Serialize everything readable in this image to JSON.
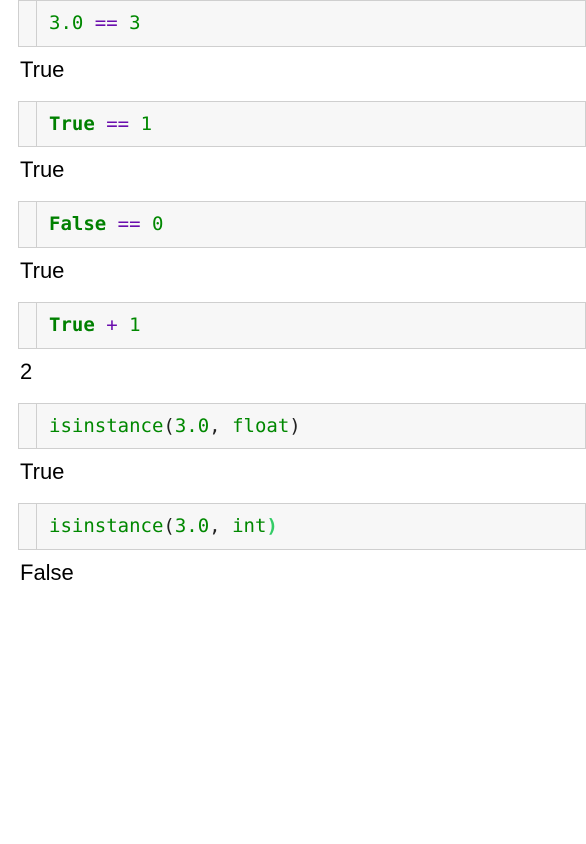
{
  "cells": [
    {
      "tokens": [
        {
          "text": "3.0",
          "cls": "tok-num"
        },
        {
          "text": " ",
          "cls": "sp"
        },
        {
          "text": "==",
          "cls": "tok-op"
        },
        {
          "text": " ",
          "cls": "sp"
        },
        {
          "text": "3",
          "cls": "tok-num"
        }
      ],
      "output": "True"
    },
    {
      "tokens": [
        {
          "text": "True",
          "cls": "tok-kw"
        },
        {
          "text": " ",
          "cls": "sp"
        },
        {
          "text": "==",
          "cls": "tok-op"
        },
        {
          "text": " ",
          "cls": "sp"
        },
        {
          "text": "1",
          "cls": "tok-num"
        }
      ],
      "output": "True"
    },
    {
      "tokens": [
        {
          "text": "False",
          "cls": "tok-kw"
        },
        {
          "text": " ",
          "cls": "sp"
        },
        {
          "text": "==",
          "cls": "tok-op"
        },
        {
          "text": " ",
          "cls": "sp"
        },
        {
          "text": "0",
          "cls": "tok-num"
        }
      ],
      "output": "True"
    },
    {
      "tokens": [
        {
          "text": "True",
          "cls": "tok-kw"
        },
        {
          "text": " ",
          "cls": "sp"
        },
        {
          "text": "+",
          "cls": "tok-op"
        },
        {
          "text": " ",
          "cls": "sp"
        },
        {
          "text": "1",
          "cls": "tok-num"
        }
      ],
      "output": "2"
    },
    {
      "tokens": [
        {
          "text": "isinstance",
          "cls": "tok-builtin"
        },
        {
          "text": "(",
          "cls": "tok-paren"
        },
        {
          "text": "3.0",
          "cls": "tok-num"
        },
        {
          "text": ",",
          "cls": "tok-comma"
        },
        {
          "text": " ",
          "cls": "sp"
        },
        {
          "text": "float",
          "cls": "tok-builtin"
        },
        {
          "text": ")",
          "cls": "tok-paren"
        }
      ],
      "output": "True"
    },
    {
      "tokens": [
        {
          "text": "isinstance",
          "cls": "tok-builtin"
        },
        {
          "text": "(",
          "cls": "tok-paren"
        },
        {
          "text": "3.0",
          "cls": "tok-num"
        },
        {
          "text": ",",
          "cls": "tok-comma"
        },
        {
          "text": " ",
          "cls": "sp"
        },
        {
          "text": "int",
          "cls": "tok-builtin"
        },
        {
          "text": ")",
          "cls": "tok-paren-hl"
        }
      ],
      "output": "False"
    }
  ]
}
